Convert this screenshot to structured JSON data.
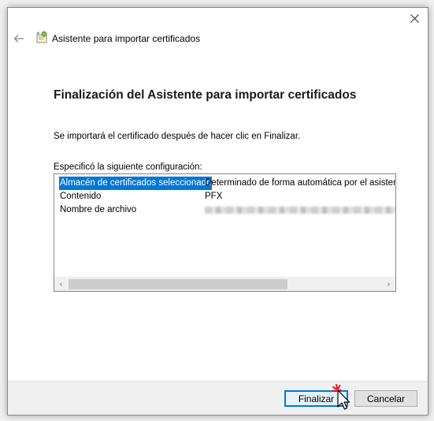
{
  "window": {
    "close_icon": "close-icon"
  },
  "header": {
    "back_icon": "back-arrow-icon",
    "wizard_icon": "certificate-wizard-icon",
    "title": "Asistente para importar certificados"
  },
  "main": {
    "heading": "Finalización del Asistente para importar certificados",
    "info": "Se importará el certificado después de hacer clic en Finalizar.",
    "config_label": "Especificó la siguiente configuración:",
    "config_rows": [
      {
        "name": "Almacén de certificados seleccionado",
        "value": "Determinado de forma automática por el asistente",
        "selected": true
      },
      {
        "name": "Contenido",
        "value": "PFX",
        "selected": false
      },
      {
        "name": "Nombre de archivo",
        "value": "",
        "selected": false
      }
    ],
    "scroll_left": "‹",
    "scroll_right": "›"
  },
  "footer": {
    "finish_label": "Finalizar",
    "cancel_label": "Cancelar"
  },
  "colors": {
    "selection": "#0078d7",
    "accent_red": "#e81123"
  }
}
